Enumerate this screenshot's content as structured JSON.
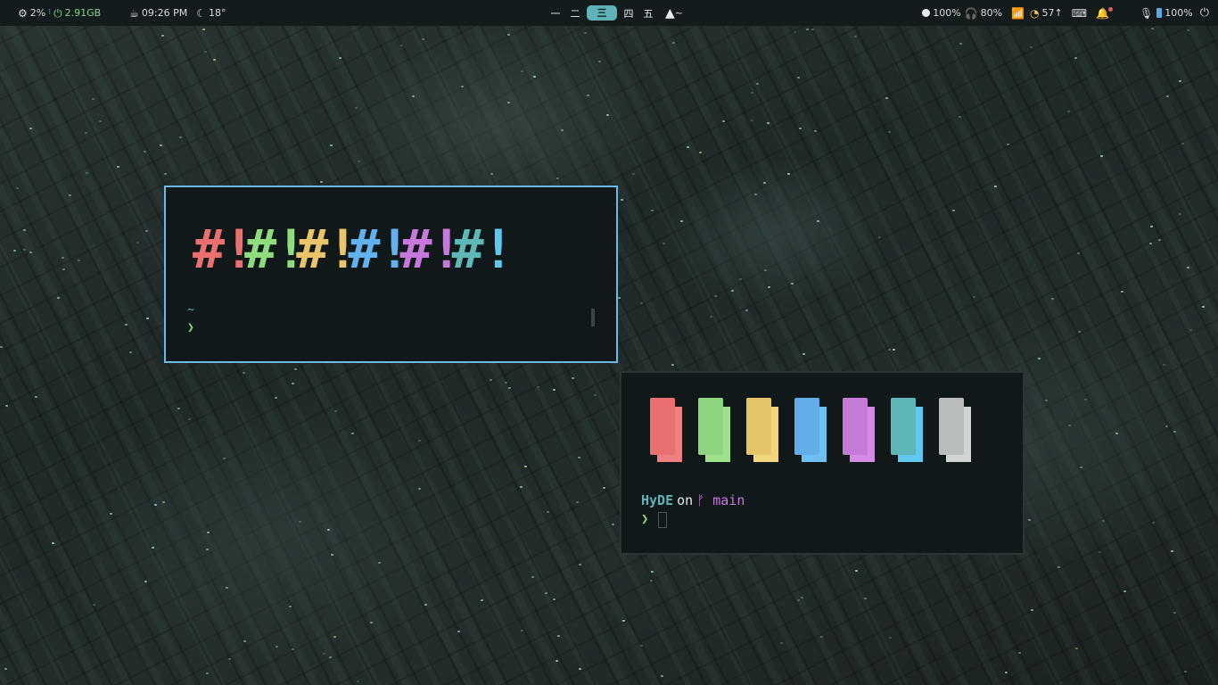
{
  "topbar": {
    "cpu_icon": "gear-icon",
    "cpu": "2%",
    "mem_icon": "memory-icon",
    "mem": "2.91GB",
    "clock_icon": "cup-icon",
    "time": "09:26 PM",
    "weather_icon": "moon-icon",
    "temp": "18°",
    "workspaces": [
      "一",
      "二",
      "三",
      "四",
      "五"
    ],
    "active_workspace": "三",
    "launcher_label": "~",
    "brightness": "100%",
    "volume": "80%",
    "updates": "57↑",
    "battery": "100%"
  },
  "terminal1": {
    "banner": [
      {
        "hash": "#",
        "bang": "!",
        "color": "#ea6f6f"
      },
      {
        "hash": "#",
        "bang": "!",
        "color": "#8fdc7e"
      },
      {
        "hash": "#",
        "bang": "!",
        "color": "#eac46a"
      },
      {
        "hash": "#",
        "bang": "!",
        "color": "#62b0ee"
      },
      {
        "hash": "#",
        "bang": "!",
        "color": "#c678dd"
      },
      {
        "hash": "#",
        "bang": "!",
        "color": "#5fb8b8",
        "bang_color": "#5ec8ee"
      }
    ],
    "cwd": "~",
    "prompt_symbol": "❯"
  },
  "terminal2": {
    "swatches": [
      {
        "front": "#e87070",
        "back": "#f08080"
      },
      {
        "front": "#8fd47e",
        "back": "#9fe08e"
      },
      {
        "front": "#e6c46a",
        "back": "#f2d57c"
      },
      {
        "front": "#62aee8",
        "back": "#6ec0f4"
      },
      {
        "front": "#c47ad6",
        "back": "#d48ae6"
      },
      {
        "front": "#5fb6b6",
        "back": "#5ec8ee"
      },
      {
        "front": "#b8bcbc",
        "back": "#d0d4d4"
      }
    ],
    "dir": "HyDE",
    "on": "on",
    "branch_icon": "git-branch-icon",
    "branch_glyph": "ᚠ",
    "branch": "main",
    "prompt_symbol": "❯"
  }
}
